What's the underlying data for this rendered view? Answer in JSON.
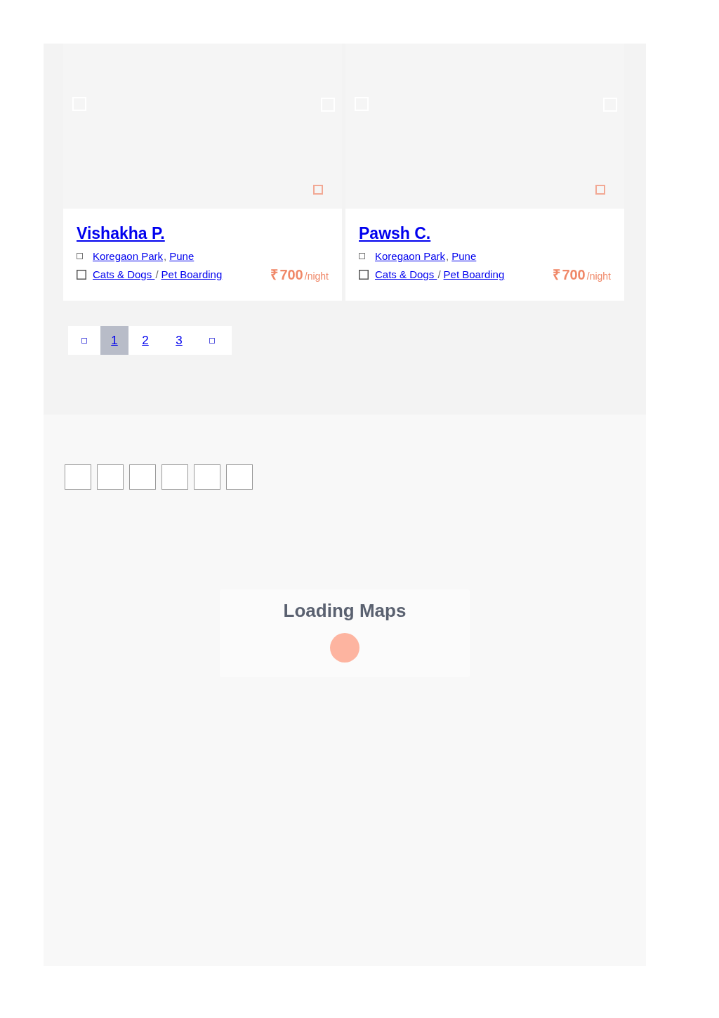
{
  "listings": [
    {
      "name": "Vishakha P.",
      "area": "Koregaon Park",
      "location_separator": ",",
      "city": "Pune",
      "pets": "Cats & Dogs ",
      "service_separator": "/",
      "service": "Pet Boarding",
      "currency": "₹",
      "price": "700",
      "unit": "/night"
    },
    {
      "name": "Pawsh C.",
      "area": "Koregaon Park",
      "location_separator": ",",
      "city": "Pune",
      "pets": "Cats & Dogs ",
      "service_separator": "/",
      "service": "Pet Boarding",
      "currency": "₹",
      "price": "700",
      "unit": "/night"
    }
  ],
  "pagination": {
    "pages": [
      {
        "label": "1",
        "selected": true
      },
      {
        "label": "2",
        "selected": false
      },
      {
        "label": "3",
        "selected": false
      }
    ]
  },
  "map": {
    "title": "Loading Maps"
  }
}
